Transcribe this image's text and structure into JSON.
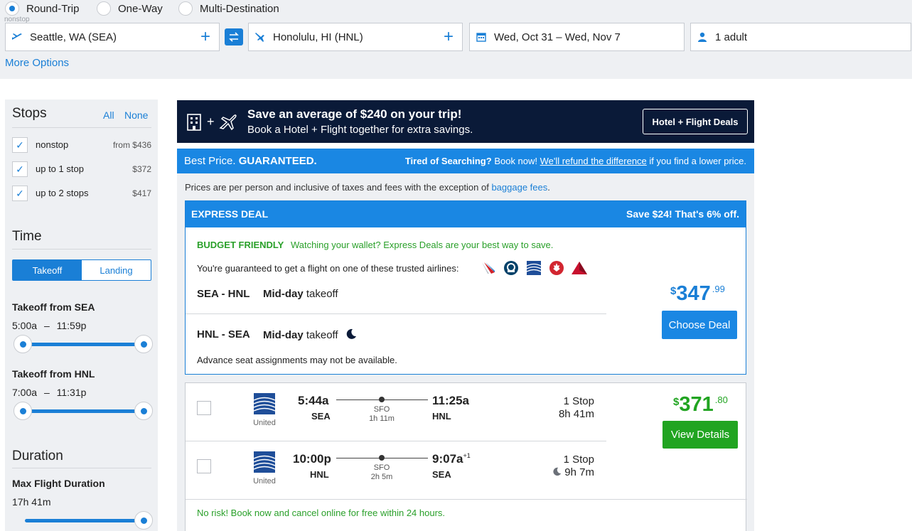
{
  "trip_type": {
    "options": [
      "Round-Trip",
      "One-Way",
      "Multi-Destination"
    ],
    "selected": "Round-Trip",
    "tooltip": "nonstop"
  },
  "search": {
    "origin": "Seattle, WA (SEA)",
    "destination": "Honolulu, HI (HNL)",
    "dates": "Wed, Oct 31 – Wed, Nov 7",
    "travelers": "1 adult",
    "more_options": "More Options"
  },
  "filters": {
    "stops": {
      "title": "Stops",
      "all": "All",
      "none": "None",
      "items": [
        {
          "label": "nonstop",
          "price": "from $436",
          "checked": true
        },
        {
          "label": "up to 1 stop",
          "price": "$372",
          "checked": true
        },
        {
          "label": "up to 2 stops",
          "price": "$417",
          "checked": true
        }
      ]
    },
    "time": {
      "title": "Time",
      "tabs": [
        "Takeoff",
        "Landing"
      ],
      "active_tab": "Takeoff",
      "sea": {
        "label": "Takeoff from SEA",
        "from": "5:00a",
        "sep": "–",
        "to": "11:59p"
      },
      "hnl": {
        "label": "Takeoff from HNL",
        "from": "7:00a",
        "sep": "–",
        "to": "11:31p"
      }
    },
    "duration": {
      "title": "Duration",
      "label": "Max Flight Duration",
      "value": "17h 41m"
    }
  },
  "banner": {
    "title": "Save an average of $240 on your trip!",
    "subtitle": "Book a Hotel + Flight together for extra savings.",
    "button": "Hotel + Flight Deals",
    "plus": "+"
  },
  "guarantee": {
    "best_price": "Best Price.",
    "guaranteed": "GUARANTEED.",
    "tired": "Tired of Searching?",
    "book_now": "Book now!",
    "refund": "We'll refund the difference",
    "lower": "if you find a lower price."
  },
  "prices_note": {
    "text": "Prices are per person and inclusive of taxes and fees with the exception of",
    "link": "baggage fees",
    "end": "."
  },
  "express": {
    "header": "EXPRESS DEAL",
    "save": "Save $24! That's 6% off.",
    "budget_tag": "BUDGET FRIENDLY",
    "budget_text": "Watching your wallet? Express Deals are your best way to save.",
    "guaranteed": "You're guaranteed to get a flight on one of these trusted airlines:",
    "airlines": [
      "american-airlines-logo",
      "alaska-airlines-logo",
      "united-logo",
      "air-canada-logo",
      "delta-logo"
    ],
    "outbound": {
      "route": "SEA - HNL",
      "time_bold": "Mid-day",
      "time_rest": "takeoff"
    },
    "inbound": {
      "route": "HNL - SEA",
      "time_bold": "Mid-day",
      "time_rest": "takeoff"
    },
    "advance": "Advance seat assignments may not be available.",
    "price": {
      "currency": "$",
      "amount": "347",
      "cents": ".99"
    },
    "button": "Choose Deal"
  },
  "flight": {
    "outbound": {
      "carrier": "United",
      "depart_time": "5:44a",
      "depart_code": "SEA",
      "via": "SFO",
      "layover": "1h 11m",
      "arrive_time": "11:25a",
      "arrive_code": "HNL",
      "arrive_offset": "",
      "stops": "1 Stop",
      "duration": "8h 41m"
    },
    "inbound": {
      "carrier": "United",
      "depart_time": "10:00p",
      "depart_code": "HNL",
      "via": "SFO",
      "layover": "2h 5m",
      "arrive_time": "9:07a",
      "arrive_code": "SEA",
      "arrive_offset": "+1",
      "stops": "1 Stop",
      "duration": "9h 7m"
    },
    "price": {
      "currency": "$",
      "amount": "371",
      "cents": ".80"
    },
    "button": "View Details",
    "no_risk": "No risk! Book now and cancel online for free within 24 hours."
  },
  "colors": {
    "accent": "#1a87e3",
    "navy": "#0a1a38",
    "green": "#21a421",
    "panel": "#eef0f3"
  }
}
